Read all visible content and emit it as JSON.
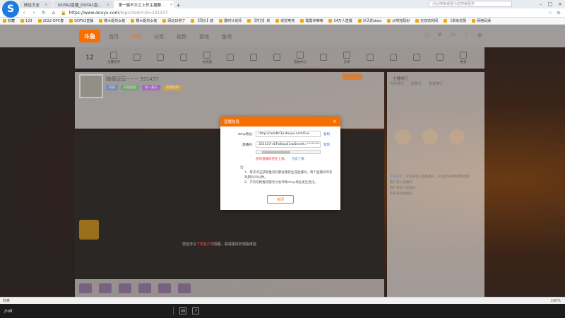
{
  "browser": {
    "tabs": [
      {
        "label": "网址大全",
        "active": false
      },
      {
        "label": "DOTA2直播_DOTA2直...",
        "active": false
      },
      {
        "label": "第一健不灭之上怀主播要...",
        "active": true
      }
    ],
    "url_host": "https://www.douyu.com",
    "url_path": "/topic/toib?rid=331437",
    "search_placeholder": "点此搜索或者为您搜索服务",
    "bookmarks": [
      "收藏",
      "123",
      "2022 DPC春",
      "DOTA2直播",
      "樱木姬的女装",
      "樱木姬的女装",
      "网站日常了",
      "【同乐】欧",
      "翻时计划师",
      "【共方】来",
      "欢悦电竞",
      "霞霞你嘛嘛",
      "34万人直播",
      "冷灭的dota",
      "从简完配射",
      "无双完的网",
      "【单级优赛",
      "网络码渠"
    ]
  },
  "site": {
    "logo": "斗鱼",
    "nav": [
      "首页",
      "直播",
      "分类",
      "视频",
      "游戏",
      "鱼吧"
    ],
    "active_nav": "直播",
    "subnav_count": "12",
    "subnav_items": [
      "主播任务",
      "",
      "",
      "",
      "",
      "大乐透",
      "",
      "",
      "",
      "活动中心",
      "",
      "分享",
      "",
      "",
      "",
      "更多"
    ]
  },
  "room": {
    "title": "随便玩玩~~~ 331437",
    "tags": [
      "风兽",
      "英雄联盟",
      "第一重天",
      "荣耀勋章"
    ],
    "video_hint_prefix": "您还可以",
    "video_hint_link": "下载客户端",
    "video_hint_suffix": "观看，获得更好的观看体验"
  },
  "chat": {
    "title": "主播排行",
    "tabs": [
      "今日排行",
      "周排行",
      "贵宾排行"
    ],
    "lines": [
      {
        "who": "系统提示：",
        "text": "欢迎来到斗鱼直播间，斗鱼倡导绿色健康直播"
      },
      {
        "who": "",
        "text": "用户进入直播间"
      },
      {
        "who": "",
        "text": "用户来到了直播间"
      },
      {
        "who": "",
        "text": "欢迎来到直播间"
      }
    ]
  },
  "modal": {
    "title": "直播信息",
    "rtmp_label": "rtmp地址:",
    "rtmp_value": "rtmp://sendtc3a.douyu.com/live",
    "copy_label": "复制",
    "key_label": "直播码:",
    "key_value": "331437rnEFo8lop31xoSecret=**************",
    "warning": "您的直播码还在上线。",
    "warning_link": "点此了解",
    "notes_title": "注:",
    "notes": [
      "1、每次点击获取推流码都会重新生成直播码，每个直播码的有效期为10分钟。",
      "2、只有切换推流服务才会导致rtmp地址发生变化。"
    ],
    "close_label": "关闭"
  },
  "statusbar": {
    "left": "检索",
    "zoom": "100%"
  },
  "taskbar": {
    "left": "/roll",
    "icons": [
      "W",
      "?"
    ]
  }
}
